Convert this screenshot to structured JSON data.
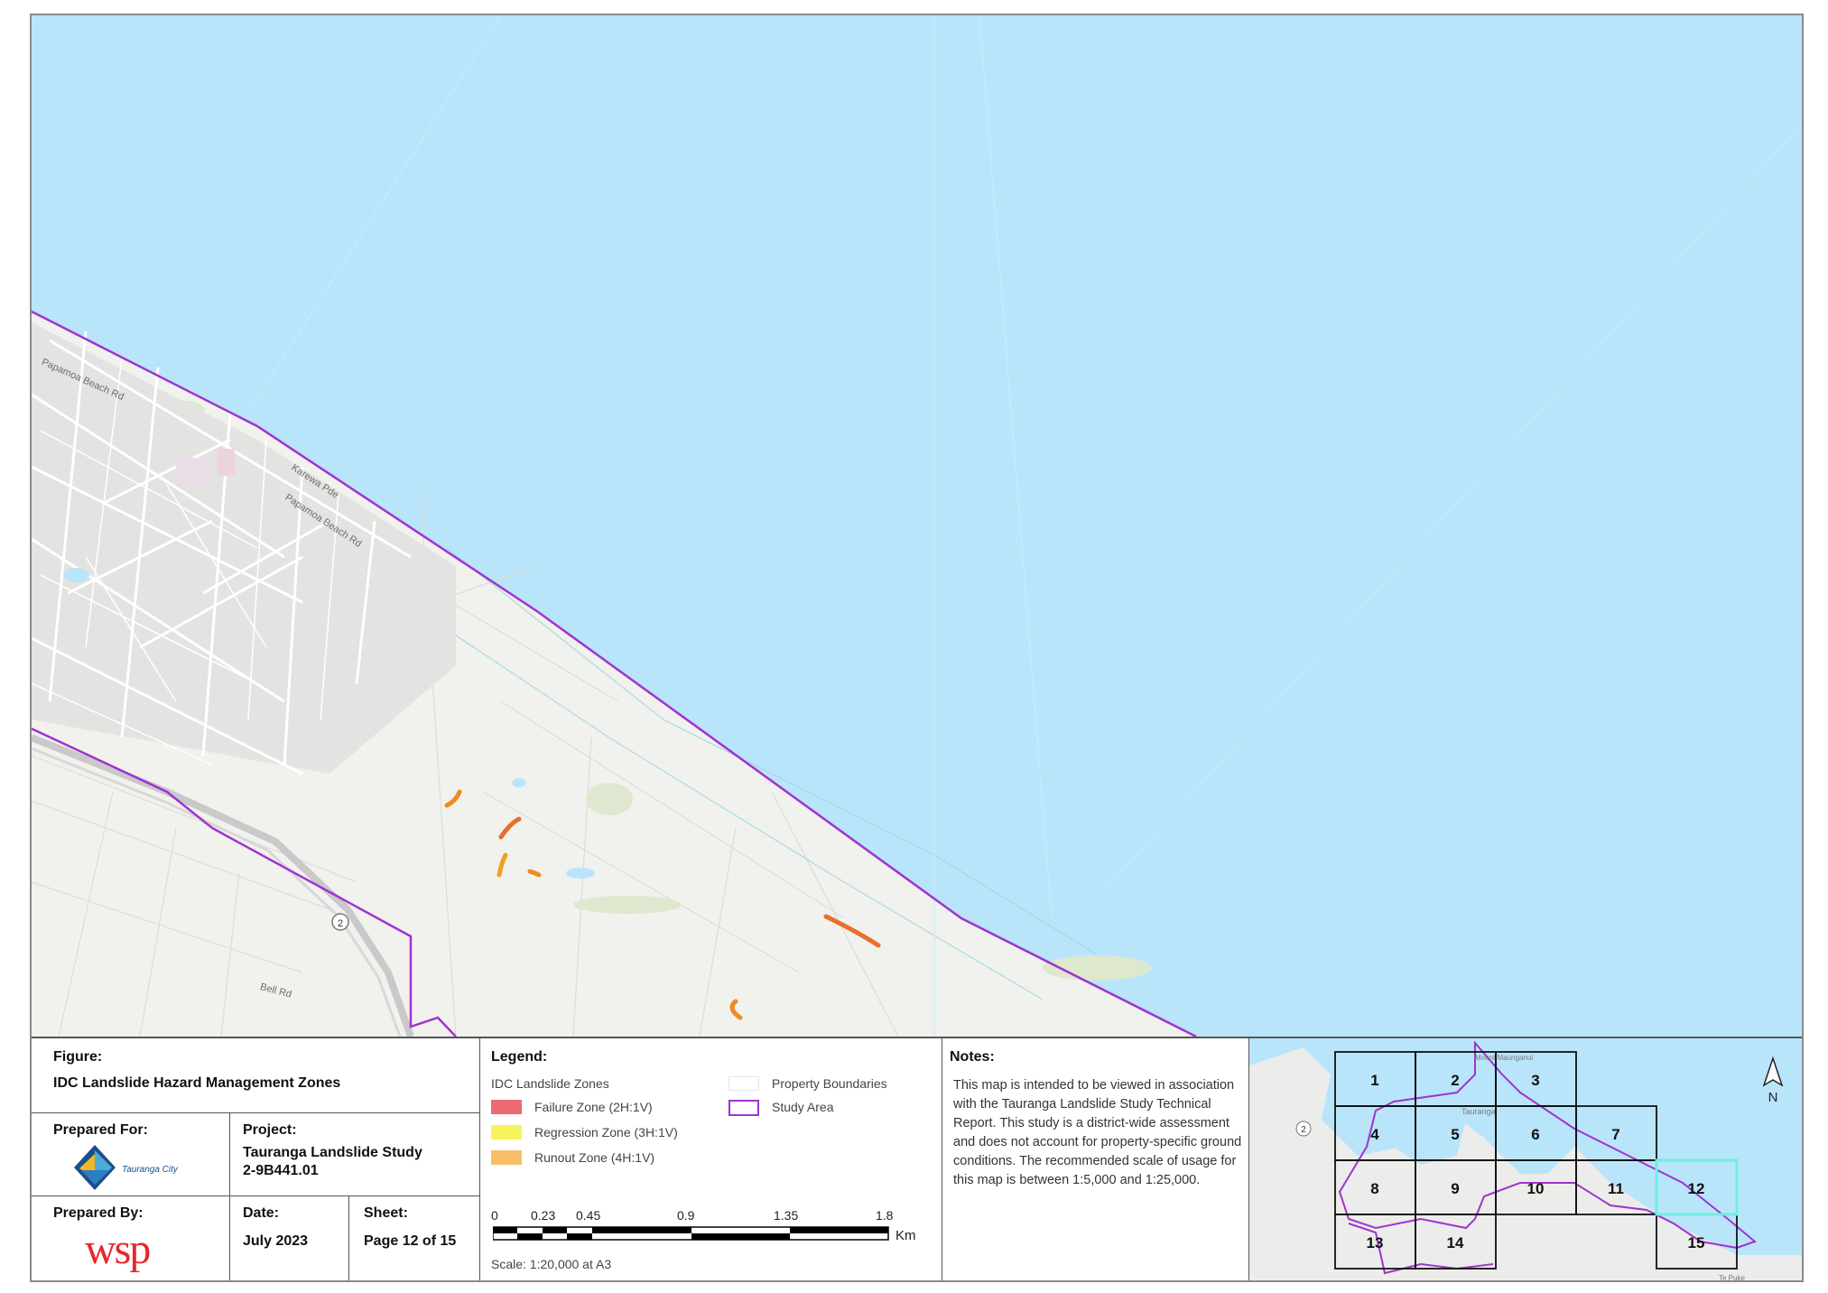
{
  "map": {
    "road_labels": [
      "Papamoa Beach Rd",
      "Karewa Pde",
      "Papamoa Beach Rd",
      "Bell Rd"
    ],
    "highway_shield": "2",
    "colors": {
      "sea": "#b9e5fb",
      "land": "#f1f1ee",
      "study_area": "#a033cf",
      "runout": "#f0a020",
      "failure": "#d94f2a"
    }
  },
  "title_block": {
    "figure_label": "Figure:",
    "figure_value": "IDC Landslide Hazard Management Zones",
    "prepared_for_label": "Prepared For:",
    "client_logo_text": "Tauranga City",
    "project_label": "Project:",
    "project_name": "Tauranga Landslide Study",
    "project_number": "2-9B441.01",
    "prepared_by_label": "Prepared By:",
    "consultant_logo": "wsp",
    "date_label": "Date:",
    "date_value": "July 2023",
    "sheet_label": "Sheet:",
    "sheet_value": "Page 12 of 15"
  },
  "legend": {
    "title": "Legend:",
    "group_title": "IDC Landslide Zones",
    "items": [
      {
        "label": "Failure Zone (2H:1V)",
        "color": "#ec6a73"
      },
      {
        "label": "Regression Zone (3H:1V)",
        "color": "#f6f45a"
      },
      {
        "label": "Runout Zone (4H:1V)",
        "color": "#f7bf6a"
      }
    ],
    "property_boundaries": "Property Boundaries",
    "study_area": "Study Area",
    "scale_ticks": [
      "0",
      "0.23",
      "0.45",
      "0.9",
      "1.35",
      "1.8"
    ],
    "scale_unit": "Km",
    "scale_text": "Scale: 1:20,000 at A3"
  },
  "notes": {
    "title": "Notes:",
    "text": "This map is intended to be viewed in association with the Tauranga Landslide Study Technical Report. This study is a district-wide assessment and does not account for property-specific ground conditions. The recommended scale of usage for this map is between 1:5,000 and 1:25,000."
  },
  "key_map": {
    "sheets": [
      "1",
      "2",
      "3",
      "4",
      "5",
      "6",
      "7",
      "8",
      "9",
      "10",
      "11",
      "12",
      "13",
      "14",
      "15"
    ],
    "current_sheet": "12",
    "place_labels": [
      "Mount Maunganui",
      "Tauranga",
      "Te Puke"
    ],
    "highway_shield": "2",
    "north": "N"
  }
}
